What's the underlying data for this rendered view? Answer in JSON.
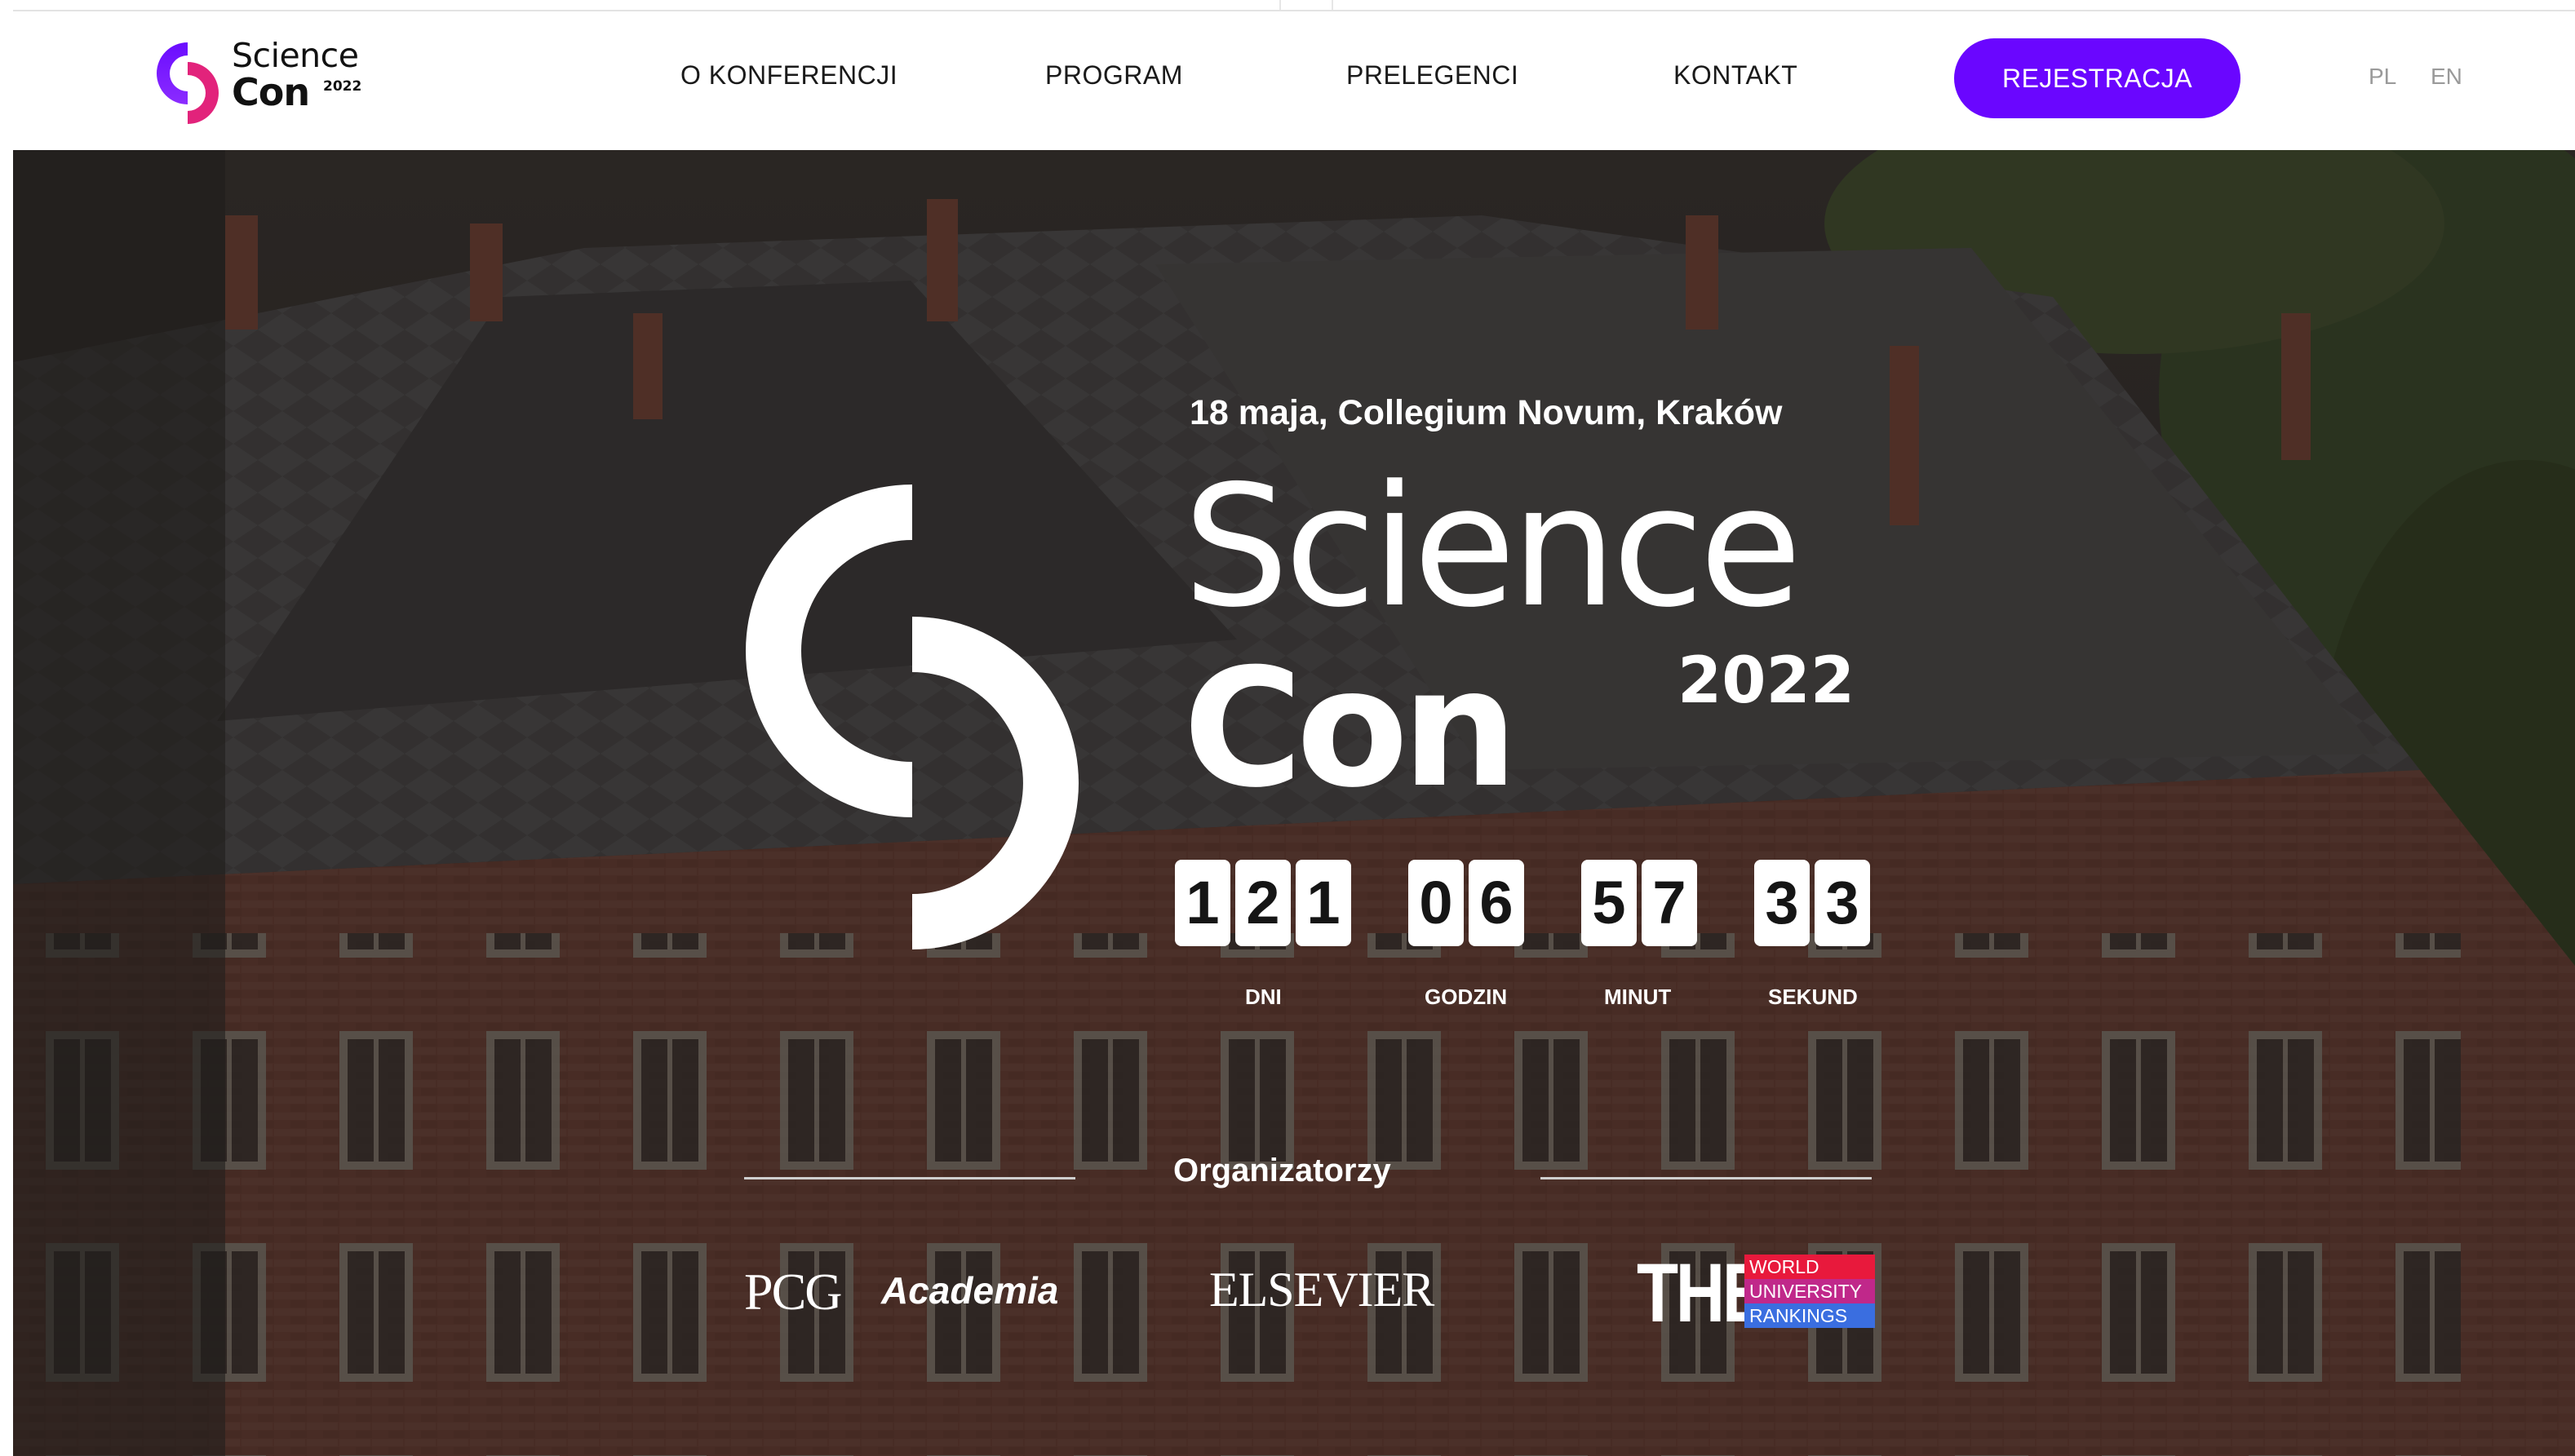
{
  "header": {
    "logo": {
      "word1": "Science",
      "word2": "Con",
      "year": "2022"
    },
    "nav": [
      {
        "label": "O KONFERENCJI"
      },
      {
        "label": "PROGRAM"
      },
      {
        "label": "PRELEGENCI"
      },
      {
        "label": "KONTAKT"
      }
    ],
    "register_label": "REJESTRACJA",
    "languages": [
      "PL",
      "EN"
    ]
  },
  "hero": {
    "venue": "18 maja, Collegium Novum, Kraków",
    "title_word1": "Science",
    "title_word2": "Con",
    "title_year": "2022",
    "countdown": [
      {
        "digits": [
          "1",
          "2",
          "1"
        ],
        "label": "DNI"
      },
      {
        "digits": [
          "0",
          "6"
        ],
        "label": "GODZIN"
      },
      {
        "digits": [
          "5",
          "7"
        ],
        "label": "MINUT"
      },
      {
        "digits": [
          "3",
          "3"
        ],
        "label": "SEKUND"
      }
    ],
    "organizers_title": "Organizatorzy",
    "organizers": {
      "pcg": "PCG",
      "academia": "Academia",
      "elsevier": "ELSEVIER",
      "the": "THE",
      "the_rows": [
        "WORLD",
        "UNIVERSITY",
        "RANKINGS"
      ]
    }
  },
  "colors": {
    "accent": "#6a06ff",
    "logo_purple": "#7a1cff",
    "logo_pink": "#e2237b",
    "the_red": "#e8193c",
    "the_pink": "#c0288a",
    "the_blue": "#3a6ee0"
  }
}
